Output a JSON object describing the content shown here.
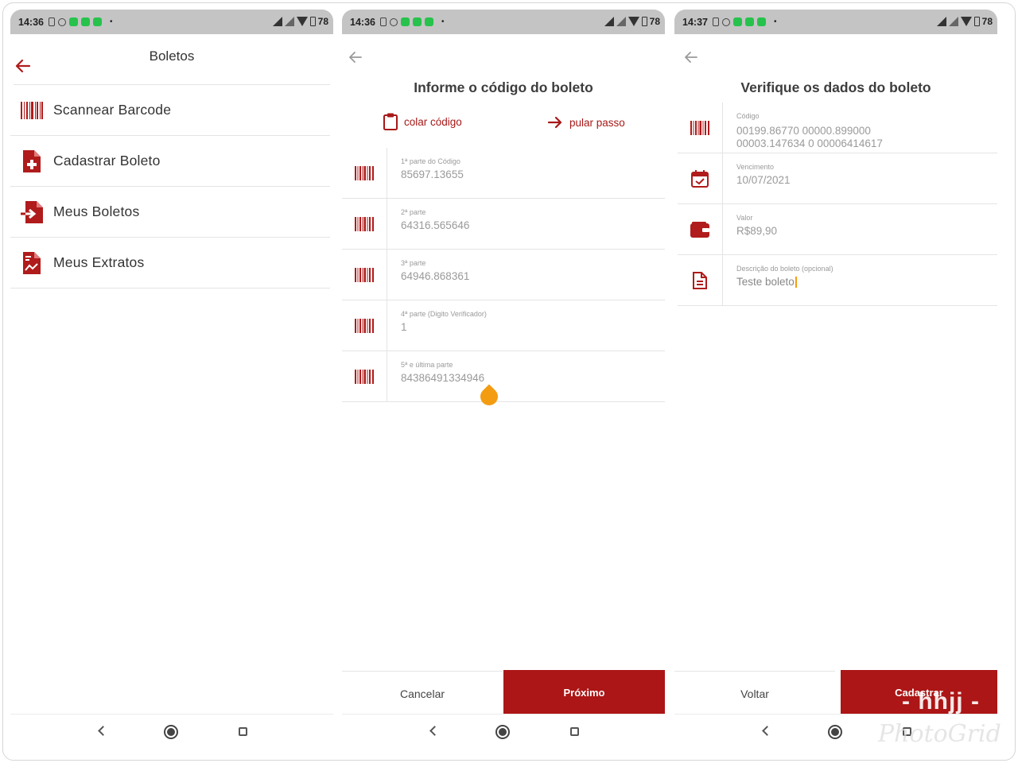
{
  "screens": [
    {
      "status": {
        "time": "14:36",
        "battery": "78"
      },
      "title": "Boletos",
      "menu": [
        {
          "label": "Scannear Barcode",
          "icon": "barcode-icon"
        },
        {
          "label": "Cadastrar Boleto",
          "icon": "file-plus-icon"
        },
        {
          "label": "Meus Boletos",
          "icon": "file-import-icon"
        },
        {
          "label": "Meus Extratos",
          "icon": "file-chart-icon"
        }
      ]
    },
    {
      "status": {
        "time": "14:36",
        "battery": "78"
      },
      "title": "Informe o código do boleto",
      "paste_label": "colar código",
      "skip_label": "pular passo",
      "fields": [
        {
          "label": "1ª parte do Código",
          "value": "85697.13655"
        },
        {
          "label": "2ª parte",
          "value": "64316.565646"
        },
        {
          "label": "3ª parte",
          "value": "64946.868361"
        },
        {
          "label": "4ª parte (Digito Verificador)",
          "value": "1"
        },
        {
          "label": "5ª e última parte",
          "value": "84386491334946"
        }
      ],
      "cancel_label": "Cancelar",
      "next_label": "Próximo"
    },
    {
      "status": {
        "time": "14:37",
        "battery": "78"
      },
      "title": "Verifique os dados do boleto",
      "fields": [
        {
          "label": "Código",
          "value": "00199.86770 00000.899000",
          "value2": "00003.147634 0 00006414617"
        },
        {
          "label": "Vencimento",
          "value": "10/07/2021"
        },
        {
          "label": "Valor",
          "value": "R$89,90"
        },
        {
          "label": "Descrição do boleto (opcional)",
          "value": "Teste boleto"
        }
      ],
      "back_label": "Voltar",
      "submit_label": "Cadastrar"
    }
  ],
  "watermark": {
    "line1": "- hhjj -",
    "line2": "PhotoGrid"
  },
  "colors": {
    "accent": "#ac1616",
    "statusbar": "#c4c4c4"
  }
}
